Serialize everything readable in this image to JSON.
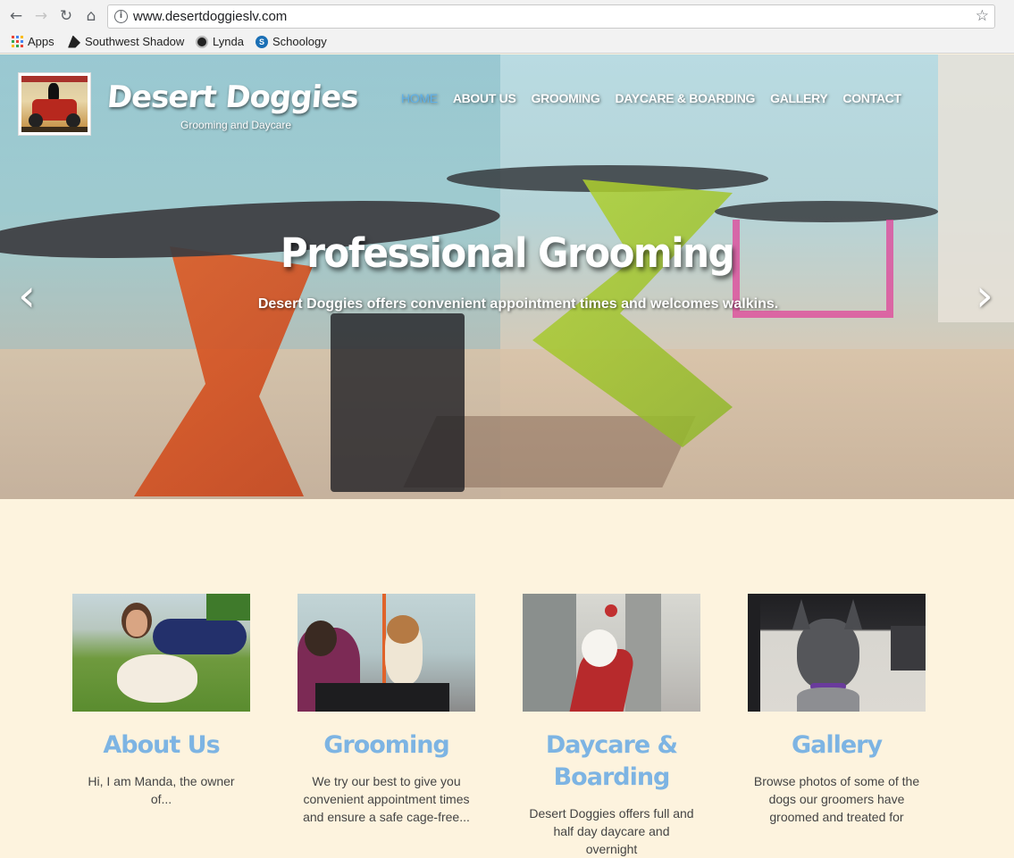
{
  "browser": {
    "url": "www.desertdoggieslv.com",
    "bookmarks": [
      "Apps",
      "Southwest Shadow",
      "Lynda",
      "Schoology"
    ]
  },
  "site": {
    "brand_name": "Desert Doggies",
    "brand_tagline": "Grooming and Daycare",
    "nav": [
      "HOME",
      "ABOUT US",
      "GROOMING",
      "DAYCARE & BOARDING",
      "GALLERY",
      "CONTACT"
    ],
    "active_nav": "HOME"
  },
  "hero": {
    "title": "Professional Grooming",
    "subtitle": "Desert Doggies offers convenient appointment times and welcomes walkins."
  },
  "features": [
    {
      "title": "About Us",
      "text": "Hi, I am Manda, the owner of..."
    },
    {
      "title": "Grooming",
      "text": "We try our best to give you convenient appointment times and ensure a safe cage-free..."
    },
    {
      "title": "Daycare & Boarding",
      "text": "Desert Doggies offers full and half day daycare and overnight"
    },
    {
      "title": "Gallery",
      "text": "Browse photos of some of the dogs our groomers have groomed and treated for"
    }
  ],
  "colors": {
    "accent": "#7db4e3",
    "active_nav": "#5fb0e8",
    "page_background": "#fdf3de"
  }
}
